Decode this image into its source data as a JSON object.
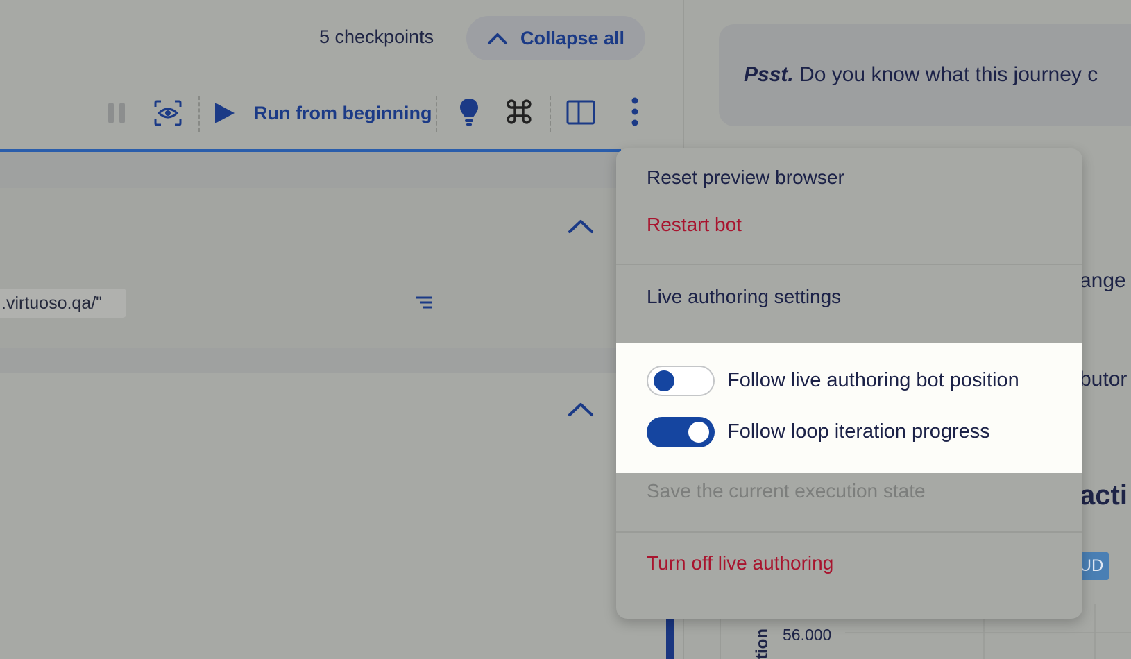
{
  "header": {
    "checkpoints_count": "5 checkpoints",
    "collapse_all_label": "Collapse all"
  },
  "toolbar": {
    "run_from_beginning_label": "Run from beginning",
    "icons": [
      "pause-icon",
      "eye-scan-icon",
      "play-icon",
      "lightbulb-icon",
      "command-icon",
      "split-panel-icon",
      "more-vertical-icon"
    ]
  },
  "steps": {
    "url_chip": ".virtuoso.qa/\""
  },
  "right_panel": {
    "psst_emphasis": "Psst.",
    "psst_text": " Do you know what this journey c",
    "fragment_1": "ange",
    "fragment_2": "butor",
    "fragment_3": "acti",
    "badge": "UD",
    "y_tick": "56.000",
    "y_axis_title": "tion"
  },
  "menu": {
    "reset_preview_browser": "Reset preview browser",
    "restart_bot": "Restart bot",
    "live_authoring_settings": "Live authoring settings",
    "follow_bot_position": "Follow live authoring bot position",
    "follow_bot_position_enabled": false,
    "follow_loop_iteration": "Follow loop iteration progress",
    "follow_loop_iteration_enabled": true,
    "save_execution_state": "Save the current execution state",
    "turn_off_live_authoring": "Turn off live authoring"
  },
  "colors": {
    "accent": "#1545a0",
    "danger": "#a8142e",
    "disabled": "#7c7e7c",
    "text": "#1c2248"
  }
}
